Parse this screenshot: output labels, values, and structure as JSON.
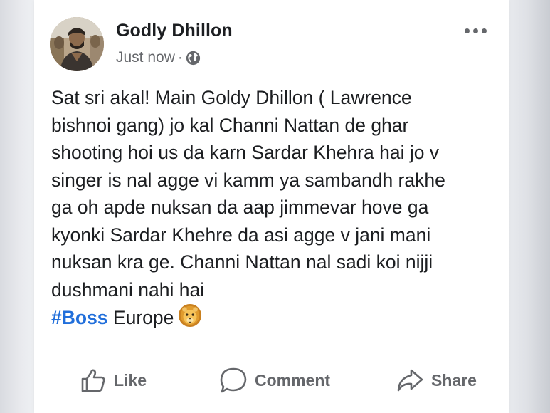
{
  "post": {
    "author": "Godly Dhillon",
    "timestamp": "Just now",
    "separator": "·",
    "privacy_icon": "globe-icon",
    "menu_icon": "more-options-icon",
    "body_lines": [
      "Sat sri akal! Main Goldy Dhillon ( Lawrence",
      "bishnoi gang) jo kal Channi Nattan de ghar",
      "shooting hoi us da karn Sardar Khehra hai jo v",
      "singer is nal agge vi kamm ya sambandh rakhe",
      "ga oh apde nuksan da aap jimmevar hove ga",
      "kyonki Sardar Khehre da asi agge v jani mani",
      "nuksan kra ge. Channi Nattan nal sadi koi nijji",
      "dushmani nahi hai"
    ],
    "hashtag": "#Boss",
    "hashtag_suffix": " Europe",
    "emoji_icon": "lion-face-icon"
  },
  "actions": {
    "like": "Like",
    "comment": "Comment",
    "share": "Share"
  },
  "colors": {
    "text": "#1c1e21",
    "secondary": "#65676b",
    "hashtag": "#216fdb"
  }
}
